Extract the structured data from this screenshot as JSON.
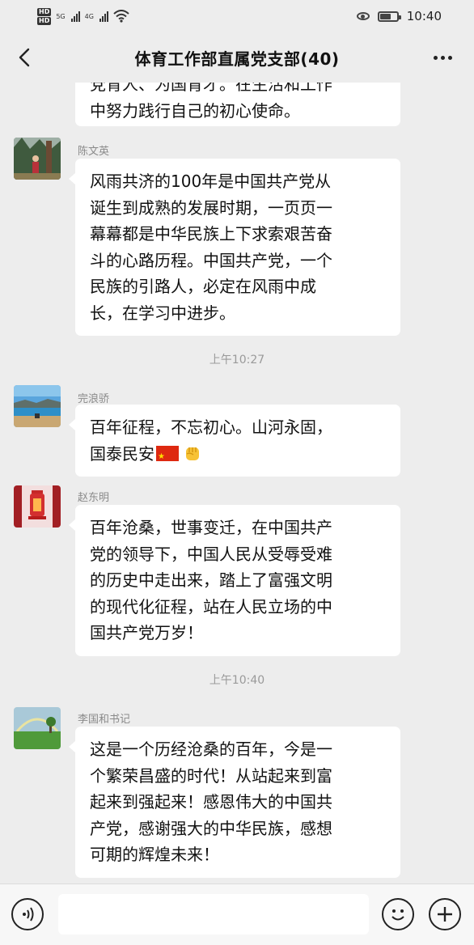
{
  "status_bar": {
    "hd_label_1": "HD",
    "hd_label_2": "HD",
    "network_1": "5G",
    "network_2": "4G",
    "time": "10:40",
    "battery_level": 0.58
  },
  "header": {
    "title": "体育工作部直属党支部(40)",
    "back_icon": "chevron-left-icon",
    "more_icon": "more-horizontal-icon"
  },
  "chat": {
    "partial_message": {
      "line_1": "党育人、为国育才。在生活和工作",
      "line_2": "中努力践行自己的初心使命。"
    },
    "messages": [
      {
        "sender": "陈文英",
        "lines": [
          "风雨共济的100年是中国共产党从",
          "诞生到成熟的发展时期，一页页一",
          "幕幕都是中华民族上下求索艰苦奋",
          "斗的心路历程。中国共产党，一个",
          "民族的引路人，必定在风雨中成",
          "长，在学习中进步。"
        ]
      },
      {
        "sender": "完浪骄",
        "lines": [
          "百年征程，不忘初心。山河永固，",
          "国泰民安"
        ],
        "emojis": [
          "china-flag-icon",
          "raised-fist-icon"
        ]
      },
      {
        "sender": "赵东明",
        "lines": [
          "百年沧桑，世事变迁，在中国共产",
          "党的领导下，中国人民从受辱受难",
          "的历史中走出来，踏上了富强文明",
          "的现代化征程，站在人民立场的中",
          "国共产党万岁！"
        ]
      },
      {
        "sender": "李国和书记",
        "lines": [
          "这是一个历经沧桑的百年，今是一",
          "个繁荣昌盛的时代！从站起来到富",
          "起来到强起来！感恩伟大的中国共",
          "产党，感谢强大的中华民族，感想",
          "可期的辉煌未来！"
        ]
      }
    ],
    "timestamps": [
      "上午10:27",
      "上午10:40"
    ]
  },
  "input_bar": {
    "voice_icon": "voice-icon",
    "emoji_icon": "smile-icon",
    "plus_icon": "plus-circle-icon",
    "text_value": ""
  },
  "colors": {
    "background": "#ededed",
    "bubble": "#ffffff",
    "sender_text": "#8a8a8a",
    "timestamp_text": "#9a9a9a"
  }
}
